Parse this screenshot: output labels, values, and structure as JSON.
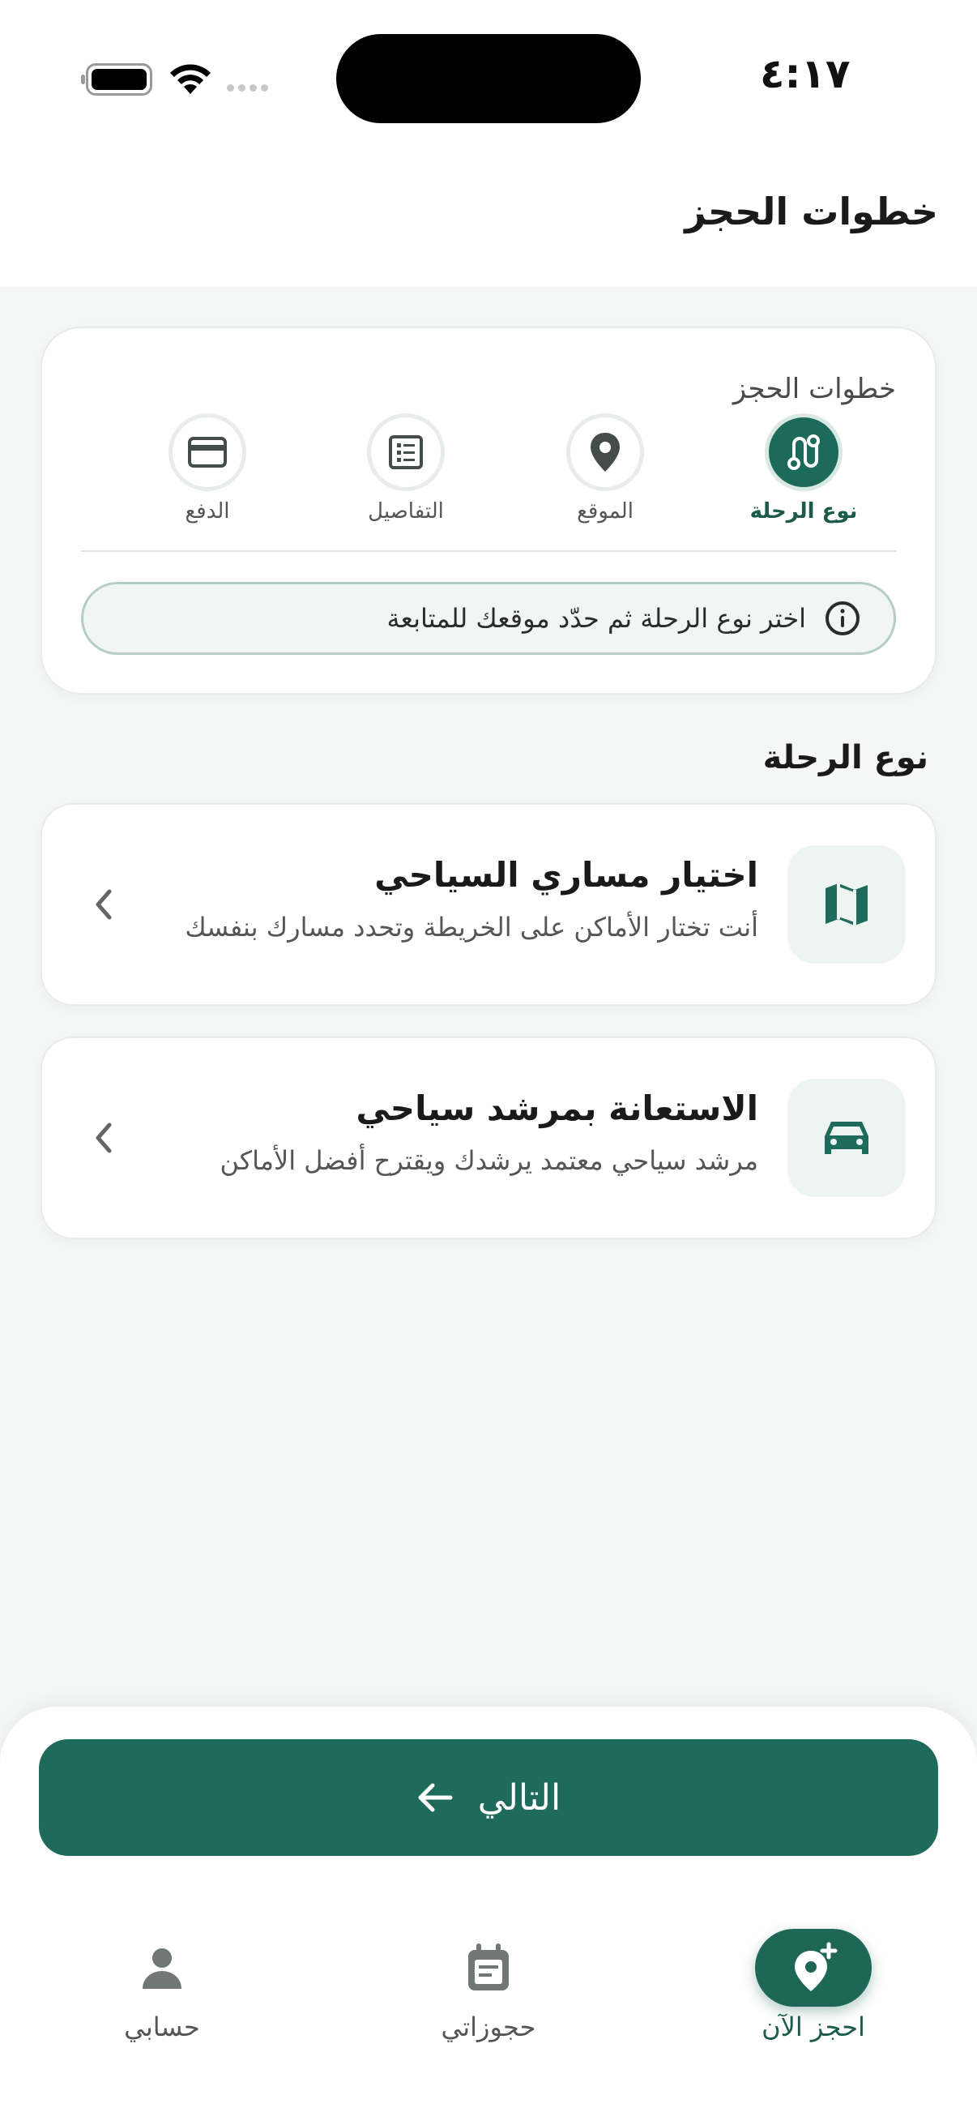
{
  "status_bar": {
    "time": "٤:١٧"
  },
  "header": {
    "title": "خطوات الحجز"
  },
  "steps": {
    "title": "خطوات الحجز",
    "items": [
      {
        "label": "نوع الرحلة",
        "icon": "route-icon",
        "active": true
      },
      {
        "label": "الموقع",
        "icon": "location-pin-icon",
        "active": false
      },
      {
        "label": "التفاصيل",
        "icon": "details-list-icon",
        "active": false
      },
      {
        "label": "الدفع",
        "icon": "credit-card-icon",
        "active": false
      }
    ],
    "hint": "اختر نوع الرحلة ثم حدّد موقعك للمتابعة"
  },
  "trip_type": {
    "section_title": "نوع الرحلة",
    "options": [
      {
        "title": "اختيار مساري السياحي",
        "description": "أنت تختار الأماكن على الخريطة وتحدد مسارك بنفسك",
        "icon": "map-icon"
      },
      {
        "title": "الاستعانة بمرشد سياحي",
        "description": "مرشد سياحي معتمد يرشدك ويقترح أفضل الأماكن",
        "icon": "car-icon"
      }
    ]
  },
  "next_button": {
    "label": "التالي"
  },
  "tabbar": {
    "items": [
      {
        "label": "احجز الآن",
        "icon": "add-location-icon",
        "active": true
      },
      {
        "label": "حجوزاتي",
        "icon": "calendar-icon",
        "active": false
      },
      {
        "label": "حسابي",
        "icon": "person-icon",
        "active": false
      }
    ]
  },
  "colors": {
    "primary": "#1f6b5b",
    "background": "#f5f7f6",
    "info_border": "#b6cdc6"
  }
}
